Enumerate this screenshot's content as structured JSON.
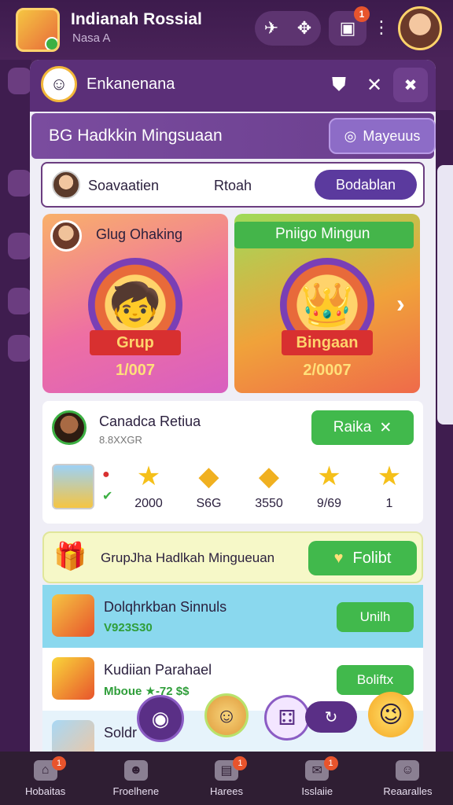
{
  "header": {
    "title": "Indianah Rossial",
    "subtitle": "Nasa A",
    "notification_count": "1"
  },
  "panel": {
    "title": "Enkanenana",
    "section_title": "Hadkkin Mingsuaan",
    "section_prefix": "BG",
    "section_button": "Mayeuus"
  },
  "search_row": {
    "name": "Soavaatien",
    "middle": "Rtoah",
    "button": "Bodablan"
  },
  "cards": [
    {
      "title": "Glug Ohaking",
      "ribbon": "Grup",
      "score": "1/007"
    },
    {
      "title": "Pniigo Mingun",
      "ribbon": "Bingaan",
      "score": "2/0007"
    }
  ],
  "candidate": {
    "name": "Canadca Retiua",
    "sub": "8.8XXGR",
    "button": "Raika",
    "rewards": [
      {
        "icon": "star-icon",
        "value": "2000"
      },
      {
        "icon": "coin-icon",
        "value": "S6G"
      },
      {
        "icon": "coin-icon",
        "value": "3550"
      },
      {
        "icon": "star-icon",
        "value": "9/69"
      },
      {
        "icon": "star-icon",
        "value": "1"
      }
    ]
  },
  "weekly": {
    "label": "GrupJha Hadlkah Mingueuan",
    "button": "Folibt"
  },
  "rows": [
    {
      "name": "Dolqhrkban Sinnuls",
      "sub": "V923S30",
      "button": "Unilh"
    },
    {
      "name": "Kudiian Parahael",
      "sub": "Mboue ★-72 $$",
      "button": "Boliftx"
    },
    {
      "name": "Soldr",
      "sub": "",
      "button": ""
    }
  ],
  "nav": [
    {
      "label": "Hobaitas",
      "icon": "home-icon",
      "badge": "1"
    },
    {
      "label": "Froelhene",
      "icon": "friends-icon",
      "badge": ""
    },
    {
      "label": "Harees",
      "icon": "hero-icon",
      "badge": "1"
    },
    {
      "label": "Isslaiie",
      "icon": "message-icon",
      "badge": "1"
    },
    {
      "label": "Reaaralles",
      "icon": "profile-icon",
      "badge": ""
    }
  ],
  "colors": {
    "brand": "#5b2f78",
    "accent_green": "#41b94c",
    "background": "#4a2359"
  }
}
